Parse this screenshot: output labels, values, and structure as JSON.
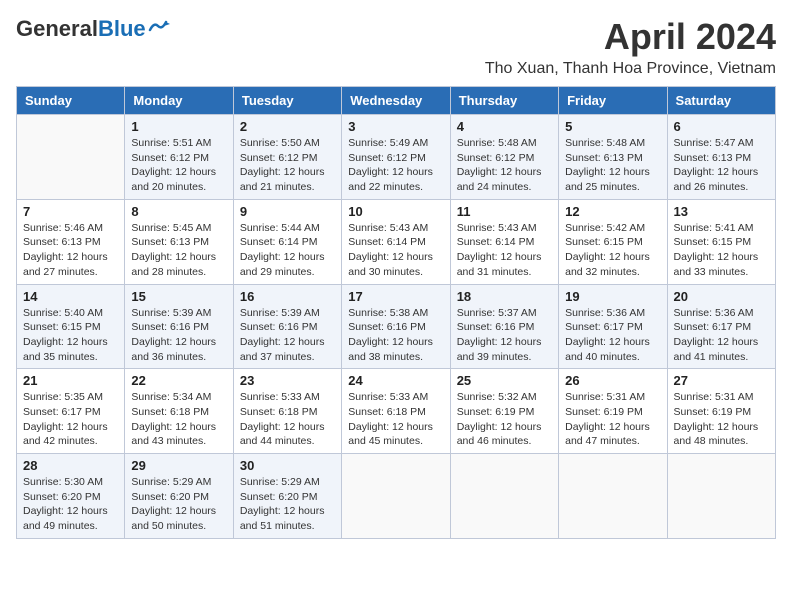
{
  "header": {
    "logo_general": "General",
    "logo_blue": "Blue",
    "month_year": "April 2024",
    "location": "Tho Xuan, Thanh Hoa Province, Vietnam"
  },
  "weekdays": [
    "Sunday",
    "Monday",
    "Tuesday",
    "Wednesday",
    "Thursday",
    "Friday",
    "Saturday"
  ],
  "weeks": [
    [
      {
        "day": "",
        "info": ""
      },
      {
        "day": "1",
        "info": "Sunrise: 5:51 AM\nSunset: 6:12 PM\nDaylight: 12 hours\nand 20 minutes."
      },
      {
        "day": "2",
        "info": "Sunrise: 5:50 AM\nSunset: 6:12 PM\nDaylight: 12 hours\nand 21 minutes."
      },
      {
        "day": "3",
        "info": "Sunrise: 5:49 AM\nSunset: 6:12 PM\nDaylight: 12 hours\nand 22 minutes."
      },
      {
        "day": "4",
        "info": "Sunrise: 5:48 AM\nSunset: 6:12 PM\nDaylight: 12 hours\nand 24 minutes."
      },
      {
        "day": "5",
        "info": "Sunrise: 5:48 AM\nSunset: 6:13 PM\nDaylight: 12 hours\nand 25 minutes."
      },
      {
        "day": "6",
        "info": "Sunrise: 5:47 AM\nSunset: 6:13 PM\nDaylight: 12 hours\nand 26 minutes."
      }
    ],
    [
      {
        "day": "7",
        "info": "Sunrise: 5:46 AM\nSunset: 6:13 PM\nDaylight: 12 hours\nand 27 minutes."
      },
      {
        "day": "8",
        "info": "Sunrise: 5:45 AM\nSunset: 6:13 PM\nDaylight: 12 hours\nand 28 minutes."
      },
      {
        "day": "9",
        "info": "Sunrise: 5:44 AM\nSunset: 6:14 PM\nDaylight: 12 hours\nand 29 minutes."
      },
      {
        "day": "10",
        "info": "Sunrise: 5:43 AM\nSunset: 6:14 PM\nDaylight: 12 hours\nand 30 minutes."
      },
      {
        "day": "11",
        "info": "Sunrise: 5:43 AM\nSunset: 6:14 PM\nDaylight: 12 hours\nand 31 minutes."
      },
      {
        "day": "12",
        "info": "Sunrise: 5:42 AM\nSunset: 6:15 PM\nDaylight: 12 hours\nand 32 minutes."
      },
      {
        "day": "13",
        "info": "Sunrise: 5:41 AM\nSunset: 6:15 PM\nDaylight: 12 hours\nand 33 minutes."
      }
    ],
    [
      {
        "day": "14",
        "info": "Sunrise: 5:40 AM\nSunset: 6:15 PM\nDaylight: 12 hours\nand 35 minutes."
      },
      {
        "day": "15",
        "info": "Sunrise: 5:39 AM\nSunset: 6:16 PM\nDaylight: 12 hours\nand 36 minutes."
      },
      {
        "day": "16",
        "info": "Sunrise: 5:39 AM\nSunset: 6:16 PM\nDaylight: 12 hours\nand 37 minutes."
      },
      {
        "day": "17",
        "info": "Sunrise: 5:38 AM\nSunset: 6:16 PM\nDaylight: 12 hours\nand 38 minutes."
      },
      {
        "day": "18",
        "info": "Sunrise: 5:37 AM\nSunset: 6:16 PM\nDaylight: 12 hours\nand 39 minutes."
      },
      {
        "day": "19",
        "info": "Sunrise: 5:36 AM\nSunset: 6:17 PM\nDaylight: 12 hours\nand 40 minutes."
      },
      {
        "day": "20",
        "info": "Sunrise: 5:36 AM\nSunset: 6:17 PM\nDaylight: 12 hours\nand 41 minutes."
      }
    ],
    [
      {
        "day": "21",
        "info": "Sunrise: 5:35 AM\nSunset: 6:17 PM\nDaylight: 12 hours\nand 42 minutes."
      },
      {
        "day": "22",
        "info": "Sunrise: 5:34 AM\nSunset: 6:18 PM\nDaylight: 12 hours\nand 43 minutes."
      },
      {
        "day": "23",
        "info": "Sunrise: 5:33 AM\nSunset: 6:18 PM\nDaylight: 12 hours\nand 44 minutes."
      },
      {
        "day": "24",
        "info": "Sunrise: 5:33 AM\nSunset: 6:18 PM\nDaylight: 12 hours\nand 45 minutes."
      },
      {
        "day": "25",
        "info": "Sunrise: 5:32 AM\nSunset: 6:19 PM\nDaylight: 12 hours\nand 46 minutes."
      },
      {
        "day": "26",
        "info": "Sunrise: 5:31 AM\nSunset: 6:19 PM\nDaylight: 12 hours\nand 47 minutes."
      },
      {
        "day": "27",
        "info": "Sunrise: 5:31 AM\nSunset: 6:19 PM\nDaylight: 12 hours\nand 48 minutes."
      }
    ],
    [
      {
        "day": "28",
        "info": "Sunrise: 5:30 AM\nSunset: 6:20 PM\nDaylight: 12 hours\nand 49 minutes."
      },
      {
        "day": "29",
        "info": "Sunrise: 5:29 AM\nSunset: 6:20 PM\nDaylight: 12 hours\nand 50 minutes."
      },
      {
        "day": "30",
        "info": "Sunrise: 5:29 AM\nSunset: 6:20 PM\nDaylight: 12 hours\nand 51 minutes."
      },
      {
        "day": "",
        "info": ""
      },
      {
        "day": "",
        "info": ""
      },
      {
        "day": "",
        "info": ""
      },
      {
        "day": "",
        "info": ""
      }
    ]
  ]
}
